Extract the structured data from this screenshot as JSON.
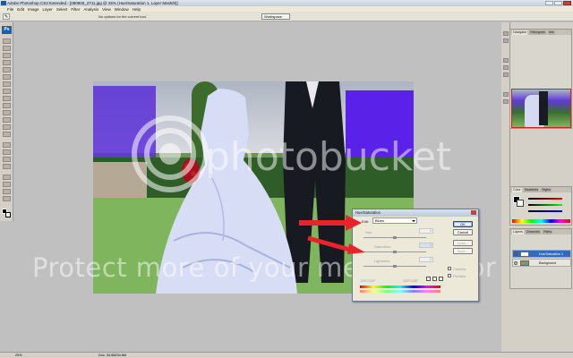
{
  "window": {
    "title": "Adobe Photoshop CS3 Extended - [090805_2711.jpg @ 25% (Hue/Saturation 1, Layer Mask/8)]",
    "controls": [
      "minimize",
      "maximize",
      "close"
    ]
  },
  "menubar": {
    "items": [
      "File",
      "Edit",
      "Image",
      "Layer",
      "Select",
      "Filter",
      "Analysis",
      "View",
      "Window",
      "Help"
    ]
  },
  "optionsbar": {
    "hint": "No options for the current tool.",
    "workspace": "Workspace"
  },
  "toolbox": {
    "badge": "Ps"
  },
  "panels": {
    "navigator_tabs": [
      "Navigator",
      "Histogram",
      "Info"
    ],
    "color_tabs": [
      "Color",
      "Swatches",
      "Styles"
    ],
    "layers_tabs": [
      "Layers",
      "Channels",
      "Paths"
    ],
    "layers": [
      {
        "name": "Hue/Saturation 1",
        "selected": true
      },
      {
        "name": "Background",
        "selected": false
      }
    ]
  },
  "statusbar": {
    "zoom": "25%",
    "doc": "Doc: 34.6M/34.6M"
  },
  "dialog": {
    "title": "Hue/Saturation",
    "edit_label": "Edit:",
    "edit_value": "Blues",
    "hue_label": "Hue:",
    "hue_value": "0",
    "saturation_label": "Saturation:",
    "saturation_value": "0",
    "lightness_label": "Lightness:",
    "lightness_value": "0",
    "range_left": "195°/225°",
    "range_right": "255°\\285°",
    "ok": "OK",
    "cancel": "Cancel",
    "load": "Load...",
    "save": "Save...",
    "colorize": "Colorize",
    "preview": "Preview"
  },
  "watermark": {
    "brand": "photobucket",
    "slogan": "Protect more of your memories for less!"
  },
  "colors": {
    "arrow": "#e8232a",
    "accent": "#316ac5"
  }
}
